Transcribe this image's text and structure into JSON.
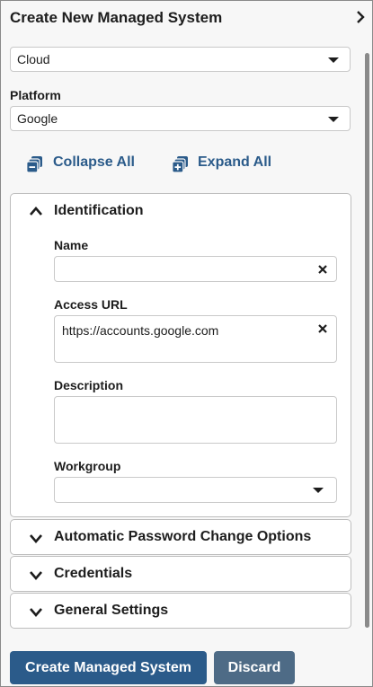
{
  "header": {
    "title": "Create New Managed System"
  },
  "type_select": {
    "value": "Cloud"
  },
  "platform": {
    "label": "Platform",
    "value": "Google"
  },
  "toolbar": {
    "collapse_label": "Collapse All",
    "expand_label": "Expand All"
  },
  "identification": {
    "title": "Identification",
    "name_label": "Name",
    "name_value": "",
    "access_url_label": "Access URL",
    "access_url_value": "https://accounts.google.com",
    "description_label": "Description",
    "description_value": "",
    "workgroup_label": "Workgroup",
    "workgroup_value": ""
  },
  "sections": [
    {
      "title": "Automatic Password Change Options"
    },
    {
      "title": "Credentials"
    },
    {
      "title": "General Settings"
    }
  ],
  "actions": {
    "create_label": "Create Managed System",
    "discard_label": "Discard"
  },
  "colors": {
    "accent": "#2b5b8a",
    "secondary_button": "#4e6b86"
  }
}
